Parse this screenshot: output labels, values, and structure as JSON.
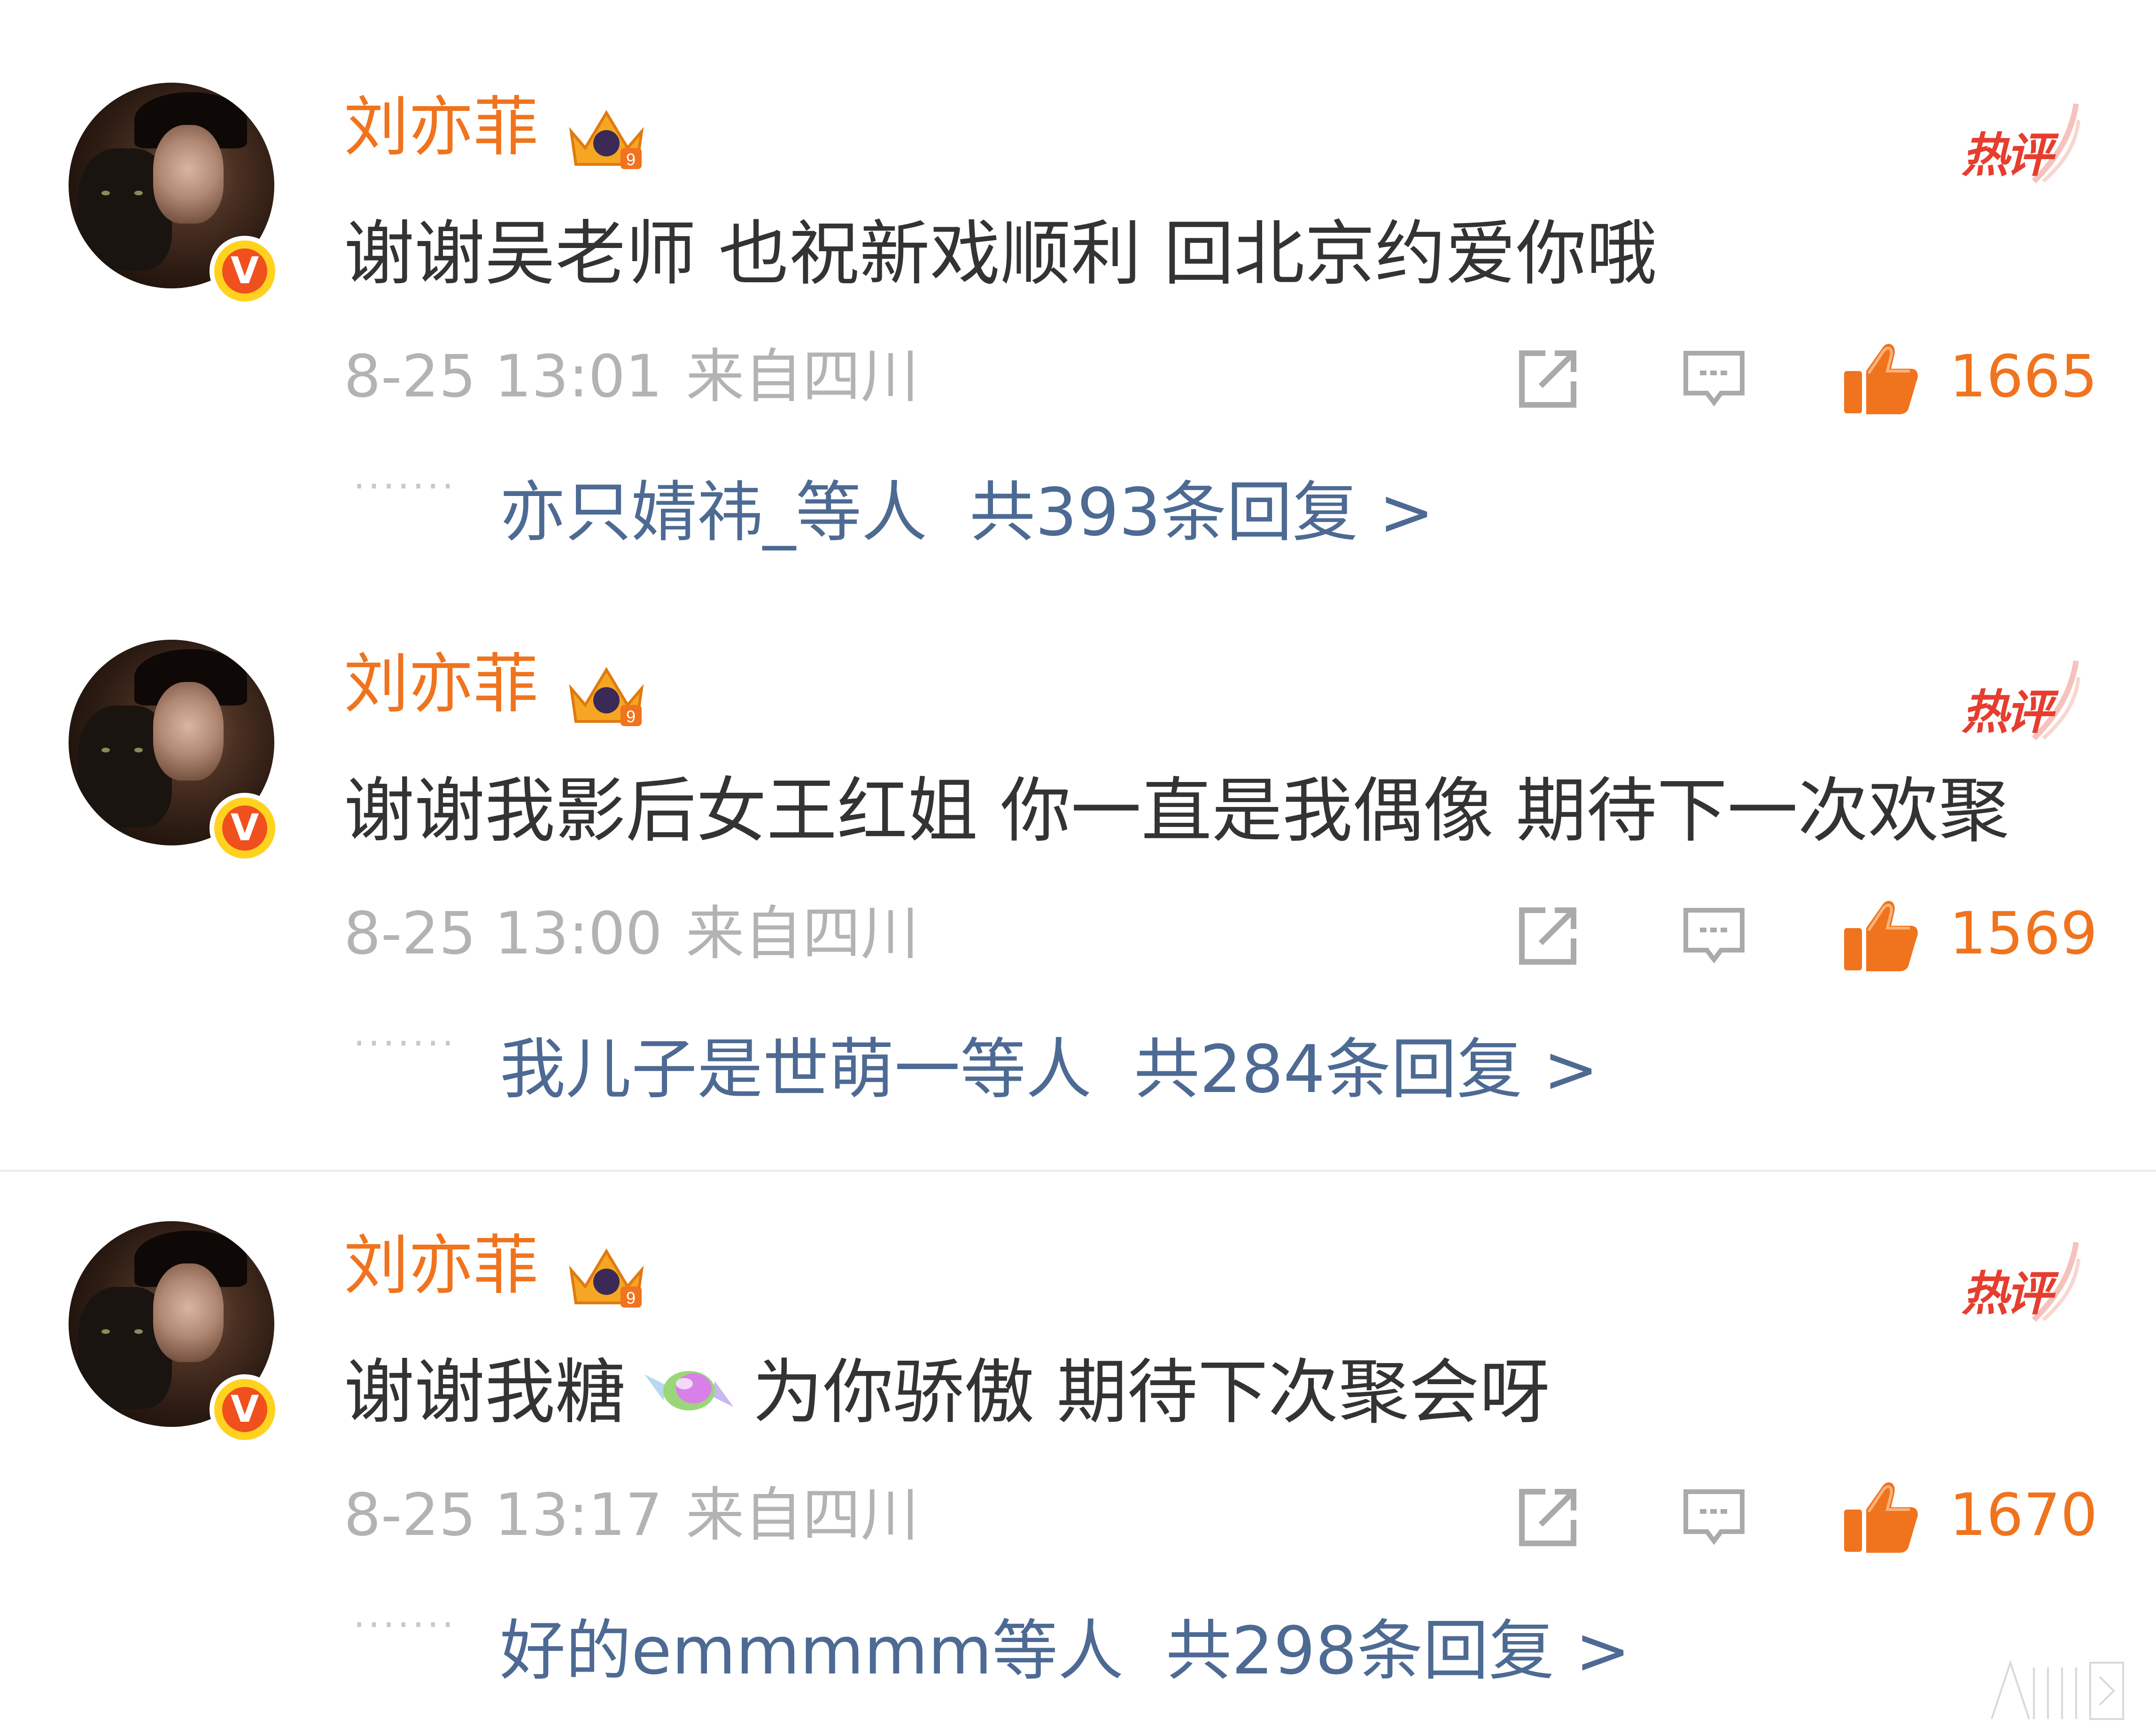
{
  "comments": [
    {
      "username": "刘亦菲",
      "hot_label": "热评",
      "text": "谢谢吴老师 也祝新戏顺利 回北京约爱你哦",
      "time": "8-25 13:01",
      "location": "来自四川",
      "likes": "1665",
      "reply_users": "亦只婧祎_等人",
      "reply_total": "共393条回复 >"
    },
    {
      "username": "刘亦菲",
      "hot_label": "热评",
      "text": "谢谢我影后女王红姐 你一直是我偶像 期待下一次欢聚",
      "time": "8-25 13:00",
      "location": "来自四川",
      "likes": "1569",
      "reply_users": "我儿子是世萌一等人",
      "reply_total": "共284条回复 >"
    },
    {
      "username": "刘亦菲",
      "hot_label": "热评",
      "text_before": "谢谢我糖",
      "text_after": "为你骄傲 期待下次聚会呀",
      "emoji": "candy",
      "time": "8-25 13:17",
      "location": "来自四川",
      "likes": "1670",
      "reply_users": "好的emmmmm等人",
      "reply_total": "共298条回复 >"
    }
  ],
  "colors": {
    "username": "#f0731e",
    "hot": "#e63d2e",
    "reply_link": "#4d6a93",
    "meta": "#b3b3b3",
    "body_text": "#333333"
  },
  "icons": [
    "share-icon",
    "comment-icon",
    "thumbs-up-icon",
    "crown-badge-icon",
    "verified-v-icon",
    "candy-emoji"
  ]
}
